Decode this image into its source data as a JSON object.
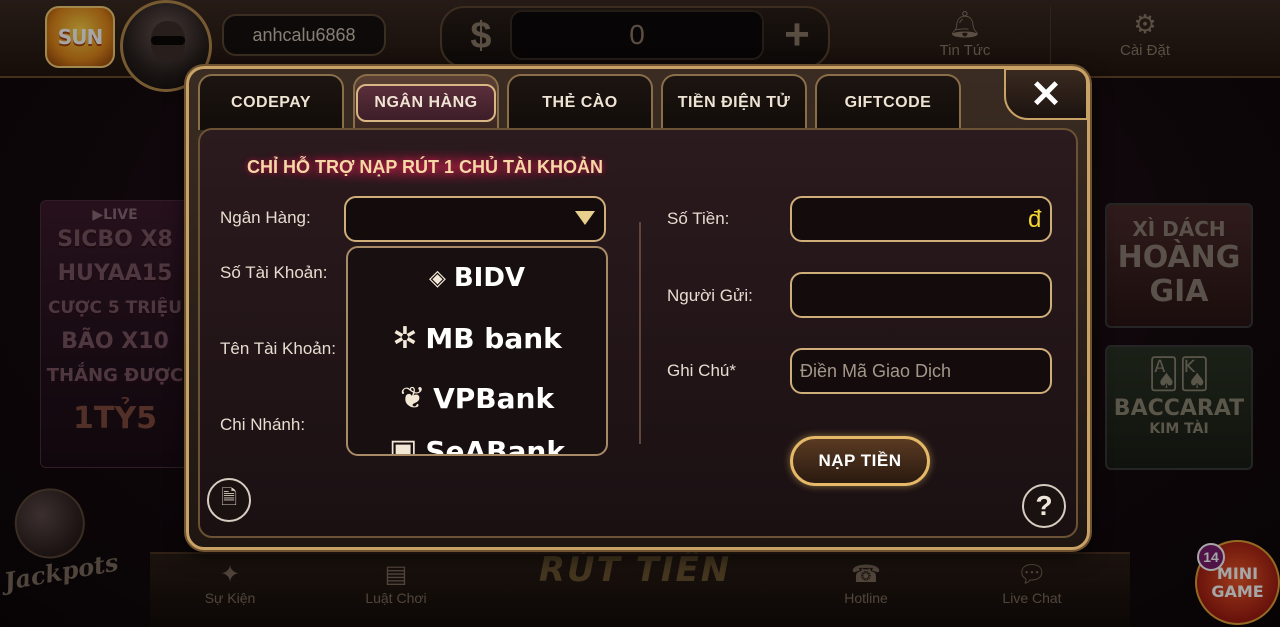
{
  "header": {
    "logo_text": "SUN",
    "username": "anhcalu6868",
    "balance": "0",
    "currency_symbol": "$",
    "add_symbol": "+",
    "news_label": "Tin Tức",
    "settings_label": "Cài Đặt"
  },
  "side": {
    "left_banner": {
      "live": "▶LIVE",
      "lines": [
        "SICBO X8",
        "HUYAA15",
        "CƯỢC 5 TRIỆU",
        "BÃO X10",
        "THẮNG ĐƯỢC"
      ],
      "amount": "1TỶ5"
    },
    "right_banner_1": {
      "line1": "XÌ DÁCH",
      "line2": "HOÀNG",
      "line3": "GIA"
    },
    "right_banner_2": {
      "line1": "BACCARAT",
      "line2": "KIM TÀI"
    },
    "jackpot": "Jackpots"
  },
  "bottom": {
    "su_kien": "Sự Kiện",
    "luat_choi": "Luật Chơi",
    "rut_tien": "RÚT TIỀN",
    "hotline": "Hotline",
    "live_chat": "Live Chat",
    "minigame": "MINI GAME",
    "minigame_badge": "14"
  },
  "modal": {
    "tabs": [
      "CODEPAY",
      "NGÂN HÀNG",
      "THẺ CÀO",
      "TIỀN ĐIỆN TỬ",
      "GIFTCODE"
    ],
    "active_tab": "NGÂN HÀNG",
    "close_symbol": "✕",
    "notice": "CHỈ HỖ TRỢ NẠP RÚT 1 CHỦ TÀI KHOẢN",
    "left_form": {
      "bank_label": "Ngân Hàng:",
      "account_number_label": "Số Tài Khoản:",
      "account_name_label": "Tên Tài Khoản:",
      "branch_label": "Chi Nhánh:",
      "bank_selected": ""
    },
    "bank_options": [
      "BIDV",
      "MB bank",
      "VPBank",
      "SeABank"
    ],
    "right_form": {
      "amount_label": "Số Tiền:",
      "amount_value": "",
      "currency_suffix": "đ",
      "sender_label": "Người Gửi:",
      "sender_value": "",
      "note_label": "Ghi Chú*",
      "note_placeholder": "Điền Mã Giao Dịch"
    },
    "submit_label": "NẠP TIỀN",
    "help_symbol": "?",
    "accent_color": "#cfae7a",
    "notice_glow_color": "#b3123d"
  }
}
